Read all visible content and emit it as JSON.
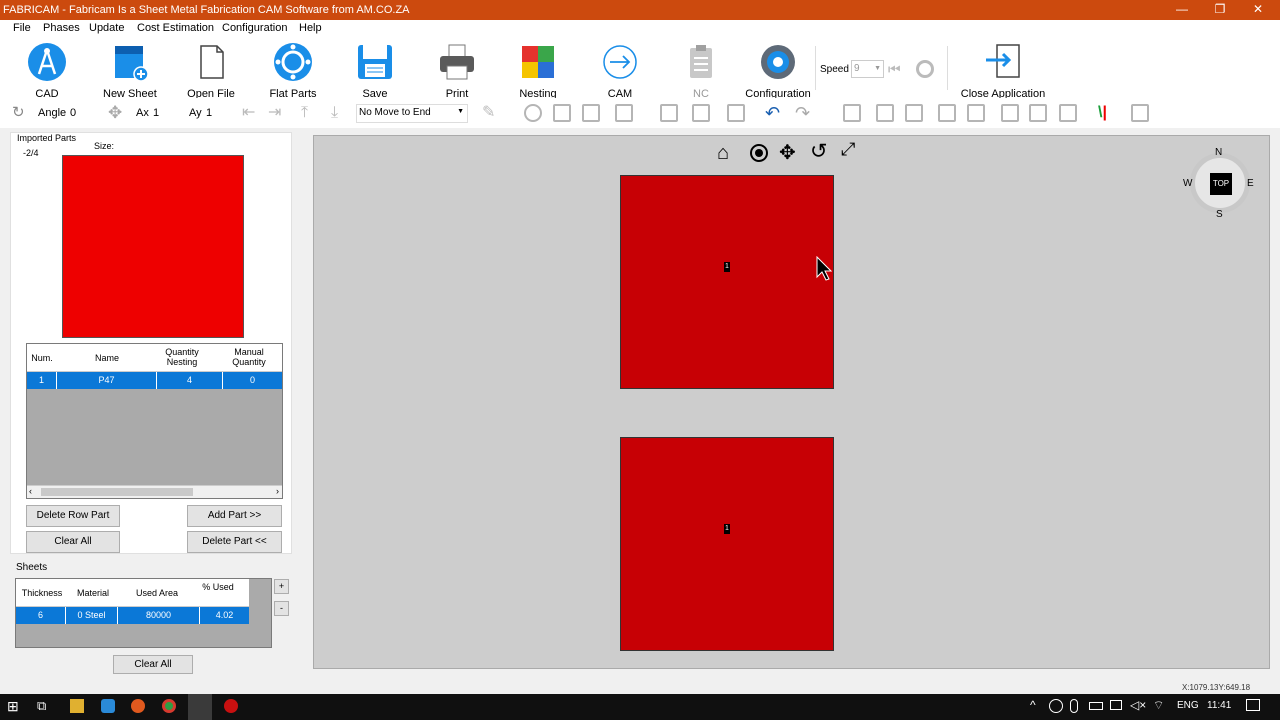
{
  "window": {
    "title": "FABRICAM - Fabricam Is a Sheet Metal Fabrication CAM Software from AM.CO.ZA",
    "minimize": "—",
    "maximize": "❐",
    "close": "✕"
  },
  "menu": [
    "File",
    "Phases",
    "Update",
    "Cost Estimation",
    "Configuration",
    "Help"
  ],
  "toolbar": {
    "buttons": [
      {
        "label": "CAD",
        "icon": "cad-compass-icon"
      },
      {
        "label": "New Sheet",
        "icon": "new-sheet-icon"
      },
      {
        "label": "Open File",
        "icon": "open-file-icon"
      },
      {
        "label": "Flat Parts",
        "icon": "flat-parts-icon"
      },
      {
        "label": "Save",
        "icon": "floppy-disk-icon"
      },
      {
        "label": "Print",
        "icon": "printer-icon"
      },
      {
        "label": "Nesting",
        "icon": "nesting-icon"
      },
      {
        "label": "CAM",
        "icon": "cam-arrow-icon"
      },
      {
        "label": "NC",
        "icon": "nc-clipboard-icon"
      },
      {
        "label": "Configuration",
        "icon": "gear-icon"
      }
    ],
    "speed_label": "Speed",
    "speed_value": "9",
    "close_label": "Close Application"
  },
  "toolbar2": {
    "angle_label": "Angle",
    "angle_value": "0",
    "ax_label": "Ax",
    "ax_value": "1",
    "ay_label": "Ay",
    "ay_value": "1",
    "move_select": "No Move to End"
  },
  "parts": {
    "title": "Imported Parts",
    "counter": "-2/4",
    "size_label": "Size:",
    "preview_color": "#ee0000",
    "columns": [
      "Num.",
      "Name",
      "Quantity Nesting",
      "Manual Quantity"
    ],
    "rows": [
      {
        "num": "1",
        "name": "P47",
        "qty_nesting": "4",
        "manual_qty": "0"
      }
    ],
    "buttons": {
      "delete_row": "Delete Row Part",
      "add_part": "Add Part >>",
      "clear_all": "Clear All",
      "delete_part": "Delete Part <<"
    }
  },
  "sheets": {
    "title": "Sheets",
    "columns": [
      "Thickness",
      "Material",
      "Used Area",
      "% Used"
    ],
    "rows": [
      {
        "thickness": "6",
        "material": "0  Steel",
        "used_area": "80000",
        "pct_used": "4.02"
      }
    ],
    "plus": "+",
    "minus": "-",
    "clear_all": "Clear All"
  },
  "viewport": {
    "part_color": "#c70005",
    "parts": [
      {
        "label": "1"
      },
      {
        "label": "1"
      }
    ],
    "compass": {
      "n": "N",
      "s": "S",
      "e": "E",
      "w": "W",
      "center": "TOP"
    }
  },
  "status": {
    "coords": "X:1079.13Y:649.18"
  },
  "taskbar": {
    "lang": "ENG",
    "time": "11:41"
  }
}
